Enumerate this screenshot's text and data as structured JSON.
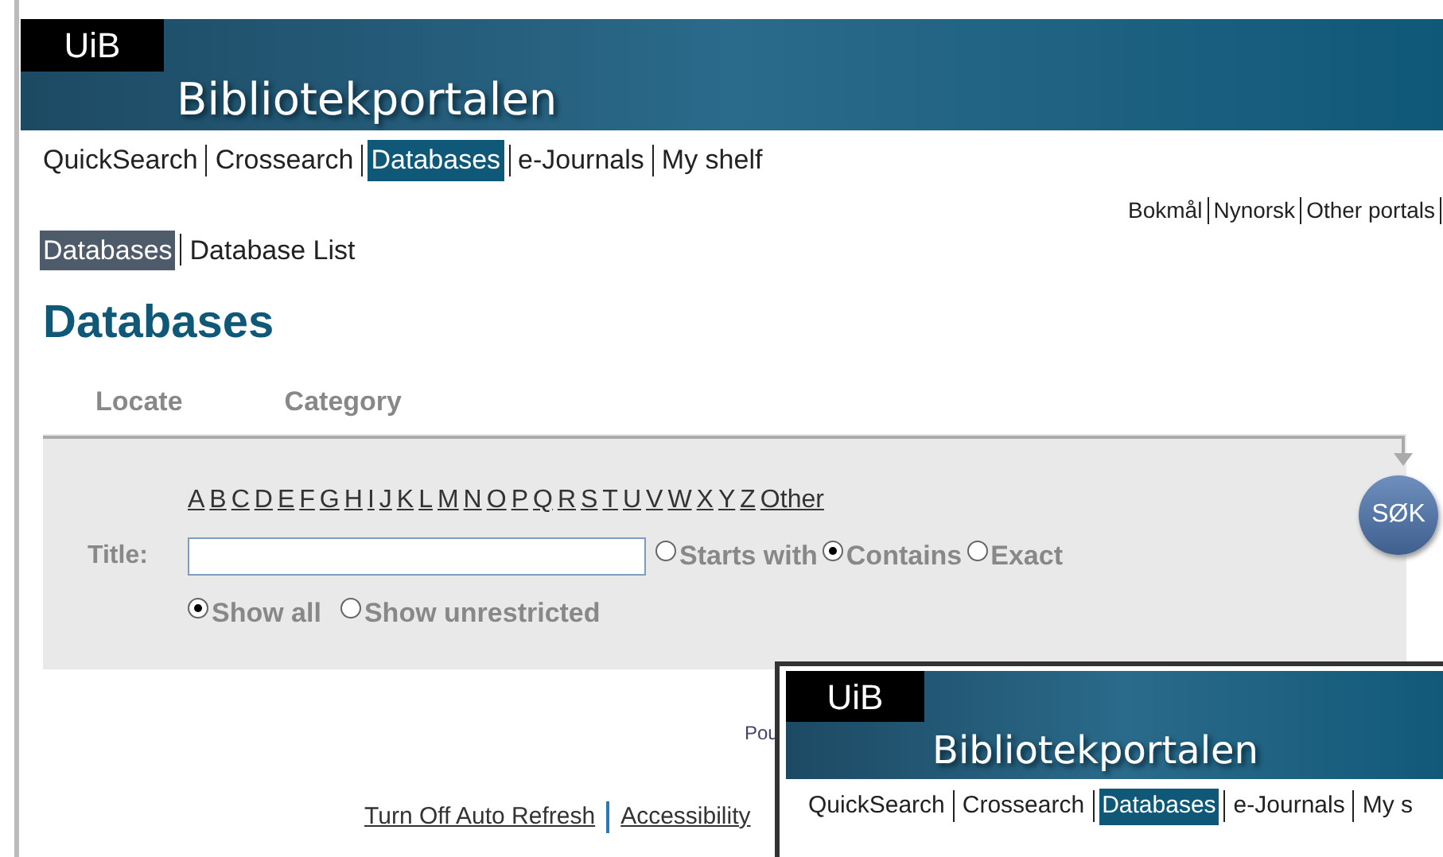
{
  "header": {
    "logo": "UiB",
    "title": "Bibliotekportalen"
  },
  "nav": [
    {
      "label": "QuickSearch",
      "selected": false
    },
    {
      "label": "Crossearch",
      "selected": false
    },
    {
      "label": "Databases",
      "selected": true
    },
    {
      "label": "e-Journals",
      "selected": false
    },
    {
      "label": "My shelf",
      "selected": false
    }
  ],
  "language_links": [
    "Bokmål",
    "Nynorsk",
    "Other portals"
  ],
  "subnav": [
    {
      "label": "Databases",
      "selected": true
    },
    {
      "label": "Database List",
      "selected": false
    }
  ],
  "heading": "Databases",
  "tabs": [
    {
      "label": "Locate",
      "selected": false
    },
    {
      "label": "Category",
      "selected": false
    }
  ],
  "letters": [
    "A",
    "B",
    "C",
    "D",
    "E",
    "F",
    "G",
    "H",
    "I",
    "J",
    "K",
    "L",
    "M",
    "N",
    "O",
    "P",
    "Q",
    "R",
    "S",
    "T",
    "U",
    "V",
    "W",
    "X",
    "Y",
    "Z",
    "Other"
  ],
  "title_field": {
    "label": "Title:"
  },
  "match_options": [
    {
      "label": "Starts with",
      "selected": false
    },
    {
      "label": "Contains",
      "selected": true
    },
    {
      "label": "Exact",
      "selected": false
    }
  ],
  "show_options": [
    {
      "label": "Show all",
      "selected": true
    },
    {
      "label": "Show unrestricted",
      "selected": false
    }
  ],
  "search_button": "SØK",
  "footer": {
    "powered": "Pou",
    "links": [
      "Turn Off Auto Refresh",
      "Accessibility"
    ]
  },
  "overlay_window": {
    "logo": "UiB",
    "title": "Bibliotekportalen",
    "nav": [
      {
        "label": "QuickSearch",
        "selected": false
      },
      {
        "label": "Crossearch",
        "selected": false
      },
      {
        "label": "Databases",
        "selected": true
      },
      {
        "label": "e-Journals",
        "selected": false
      },
      {
        "label": "My s",
        "selected": false
      }
    ]
  }
}
